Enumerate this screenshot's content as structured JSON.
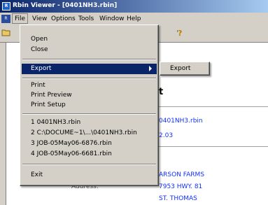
{
  "window": {
    "title": "Rbin Viewer - [0401NH3.rbin]",
    "app_icon": "rbin-app-icon"
  },
  "menubar": {
    "items": [
      {
        "label": "File"
      },
      {
        "label": "View"
      },
      {
        "label": "Options"
      },
      {
        "label": "Tools"
      },
      {
        "label": "Window"
      },
      {
        "label": "Help"
      }
    ]
  },
  "toolbar": {
    "icons": [
      "open-folder-icon",
      "help-icon"
    ]
  },
  "file_menu": {
    "items": [
      {
        "label": "Open"
      },
      {
        "label": "Close"
      },
      {
        "label": "Export"
      },
      {
        "label": "Print"
      },
      {
        "label": "Print Preview"
      },
      {
        "label": "Print Setup"
      },
      {
        "label": "1 0401NH3.rbin"
      },
      {
        "label": "2 C:\\DOCUME~1\\...\\0401NH3.rbin"
      },
      {
        "label": "3 JOB-05May06-6876.rbin"
      },
      {
        "label": "4 JOB-05May06-6681.rbin"
      },
      {
        "label": "Exit"
      }
    ],
    "submenu": {
      "label": "Export"
    }
  },
  "document": {
    "heading_partial": "t",
    "filename": "0401NH3.rbin",
    "version": "2.03",
    "customer": "ARSON FARMS",
    "address_label": "Address:",
    "address_line1": "7953 HWY. 81",
    "address_line2": "ST. THOMAS"
  },
  "colors": {
    "titlebar_start": "#0a246a",
    "titlebar_end": "#a6caf0",
    "menu_highlight": "#0a246a",
    "link_blue": "#1030ff",
    "chrome": "#d4d0c8"
  }
}
